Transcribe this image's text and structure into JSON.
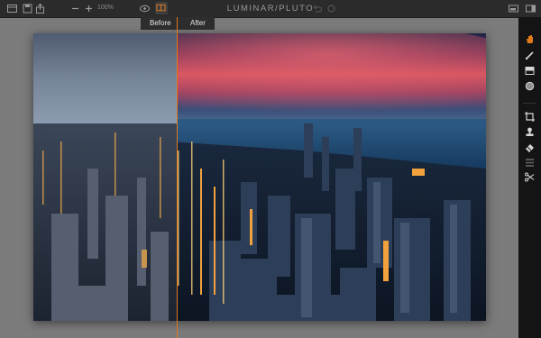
{
  "app": {
    "title": "LUMINAR/PLUTO"
  },
  "toolbar": {
    "zoom_value": "100%",
    "left_icons": [
      "panel-layout-icon",
      "save-icon",
      "share-icon",
      "zoom-out-icon",
      "zoom-in-icon"
    ],
    "center_icons": [
      "preview-eye-icon",
      "split-view-icon"
    ],
    "history_icons": [
      "undo-icon",
      "redo-icon"
    ],
    "right_icons": [
      "histogram-icon",
      "side-panel-icon"
    ]
  },
  "compare": {
    "before_label": "Before",
    "after_label": "After",
    "split_position": 0.32
  },
  "right_tools": [
    "brush-hand-icon",
    "brush-icon",
    "gradient-icon",
    "radial-mask-icon",
    "crop-icon",
    "clone-stamp-icon",
    "eraser-icon",
    "layers-icon",
    "transform-icon"
  ],
  "colors": {
    "accent": "#e07a1d",
    "toolbar_bg": "#2b2b2b",
    "canvas_bg": "#7b7b7b",
    "panel_bg": "#141414"
  }
}
